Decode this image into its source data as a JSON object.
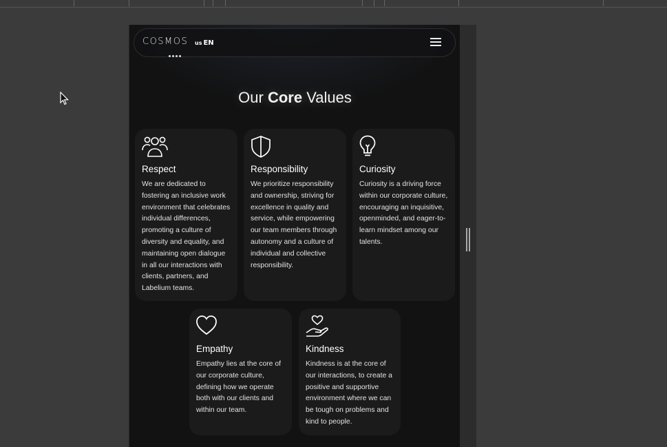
{
  "navbar": {
    "logo": "COSMOS",
    "lang_flag": "us",
    "lang_label": "EN"
  },
  "heading": {
    "pre": "Our ",
    "bold": "Core",
    "post": " Values"
  },
  "values": [
    {
      "icon": "people-icon",
      "title": "Respect",
      "description": "We are dedicated to fostering an inclusive work environment that celebrates individual differences, promoting a culture of diversity and equality, and maintaining open dialogue in all our interactions with clients, partners, and Labelium teams."
    },
    {
      "icon": "shield-icon",
      "title": "Responsibility",
      "description": "We prioritize responsibility and ownership, striving for excellence in quality and service, while empowering our team members through autonomy and a culture of individual and collective responsibility."
    },
    {
      "icon": "lightbulb-icon",
      "title": "Curiosity",
      "description": "Curiosity is a driving force within our corporate culture, encouraging an inquisitive, openminded, and eager-to-learn mindset among our talents."
    },
    {
      "icon": "heart-icon",
      "title": "Empathy",
      "description": "Empathy lies at the core of our corporate culture, defining how we operate both with our clients and within our team."
    },
    {
      "icon": "hand-heart-icon",
      "title": "Kindness",
      "description": "Kindness is at the core of our interactions, to create a positive and supportive environment where we can be tough on problems and kind to people."
    }
  ]
}
